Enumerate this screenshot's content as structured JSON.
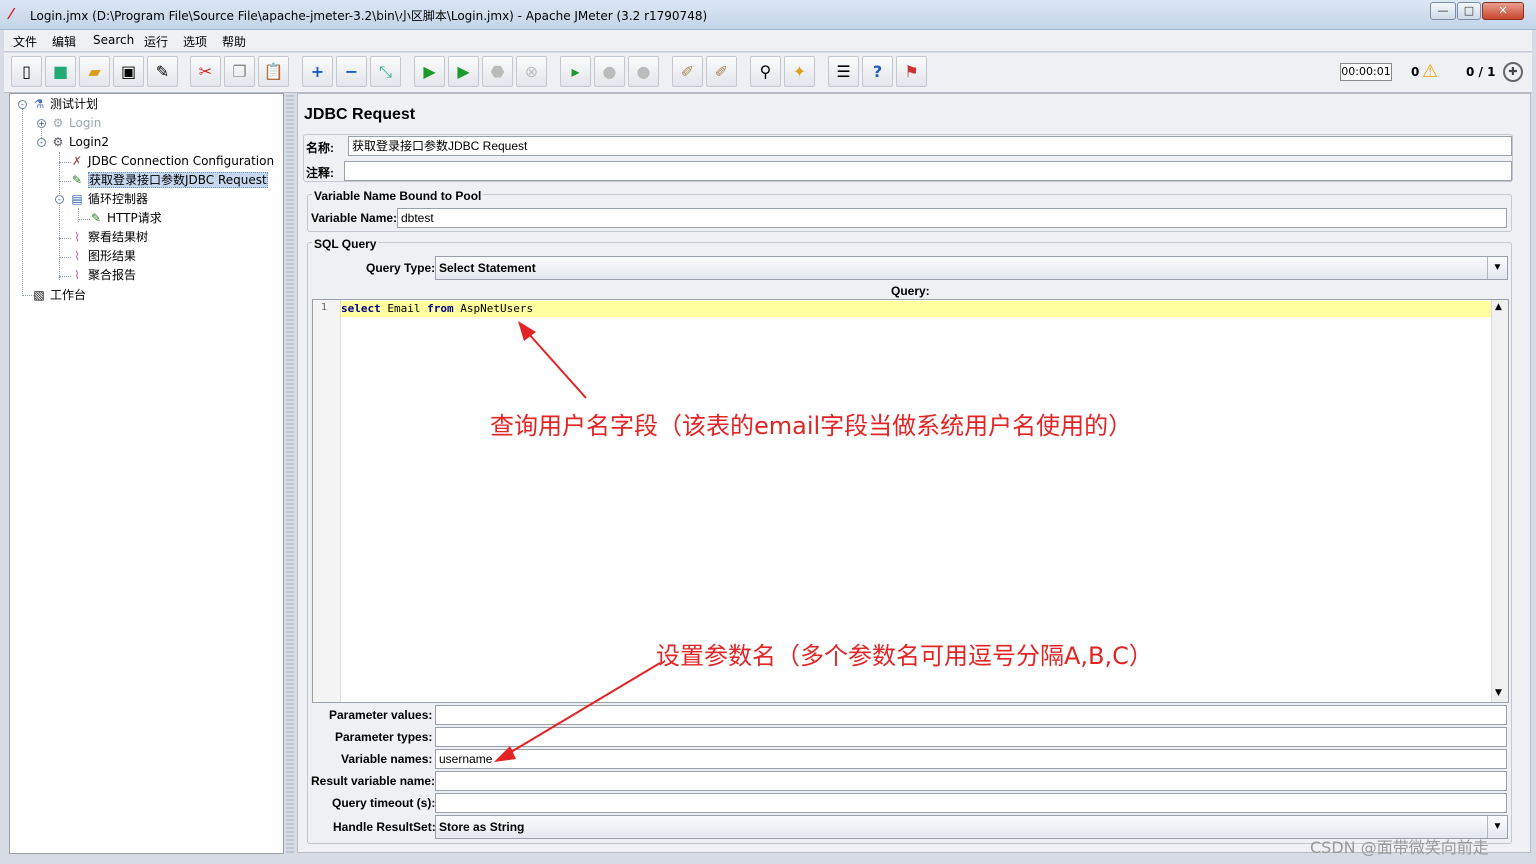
{
  "window": {
    "title": "Login.jmx (D:\\Program File\\Source File\\apache-jmeter-3.2\\bin\\小区脚本\\Login.jmx) - Apache JMeter (3.2 r1790748)"
  },
  "menu": [
    "文件",
    "编辑",
    "Search",
    "运行",
    "选项",
    "帮助"
  ],
  "status": {
    "timer": "00:00:01",
    "warnings": "0",
    "threads": "0 / 1"
  },
  "tree": {
    "root": "测试计划",
    "login": "Login",
    "login2": "Login2",
    "jdbc_config": "JDBC Connection Configuration",
    "jdbc_request": "获取登录接口参数JDBC Request",
    "loop": "循环控制器",
    "http": "HTTP请求",
    "view_results": "察看结果树",
    "graph_results": "图形结果",
    "aggregate": "聚合报告",
    "workbench": "工作台"
  },
  "panel": {
    "heading": "JDBC Request",
    "name_label": "名称:",
    "name_value": "获取登录接口参数JDBC Request",
    "comment_label": "注释:",
    "comment_value": "",
    "pool_group": "Variable Name Bound to Pool",
    "var_name_label": "Variable Name:",
    "var_name_value": "dbtest",
    "sql_group": "SQL Query",
    "query_type_label": "Query Type:",
    "query_type_value": "Select Statement",
    "query_label": "Query:",
    "line_number": "1",
    "query_kw1": "select",
    "query_mid": " Email ",
    "query_kw2": "from",
    "query_end": " AspNetUsers",
    "param_values_label": "Parameter values:",
    "param_values": "",
    "param_types_label": "Parameter types:",
    "param_types": "",
    "variable_names_label": "Variable names:",
    "variable_names": "username",
    "result_var_label": "Result variable name:",
    "result_var": "",
    "timeout_label": "Query timeout (s):",
    "timeout": "",
    "handle_label": "Handle ResultSet:",
    "handle_value": "Store as String"
  },
  "annotations": {
    "a1": "查询用户名字段（该表的email字段当做系统用户名使用的）",
    "a2": "设置参数名（多个参数名可用逗号分隔A,B,C）"
  },
  "watermark": "CSDN @面带微笑向前走",
  "colors": {
    "annotation": "#e32424",
    "query_highlight": "#ffffa0",
    "keyword": "#00008b"
  }
}
